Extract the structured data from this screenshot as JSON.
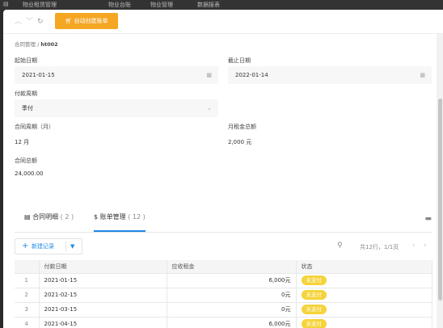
{
  "nav": {
    "items": [
      "物业租赁管理",
      "物业台账",
      "物业管理",
      "数据报表"
    ]
  },
  "toolbar": {
    "up_icon": "chevron-up-icon",
    "down_icon": "chevron-down-icon",
    "refresh_icon": "refresh-icon",
    "auto_bill_label": "自动创建账单"
  },
  "breadcrumb": {
    "parent": "合同管理",
    "current": "ht002"
  },
  "form": {
    "start_label": "起始日期",
    "start_value": "2021-01-15",
    "end_label": "截止日期",
    "end_value": "2022-01-14",
    "cycle_label": "付款周期",
    "cycle_value": "季付",
    "period_label": "合同周期（月）",
    "period_value": "12 月",
    "monthly_label": "月租金总额",
    "monthly_value": "2,000 元",
    "total_label": "合同总额",
    "total_value": "24,000.00"
  },
  "tabs": [
    {
      "label": "合同明细",
      "count": "( 2 )"
    },
    {
      "label": "账单管理",
      "count": "( 12 )"
    }
  ],
  "list_toolbar": {
    "new_label": "新建记录",
    "pager_text": "共12行，1/1页"
  },
  "table": {
    "headers": [
      "",
      "付款日期",
      "应收租金",
      "状态"
    ],
    "rows": [
      {
        "idx": "1",
        "date": "2021-01-15",
        "amount": "6,000元",
        "status": "未支付"
      },
      {
        "idx": "2",
        "date": "2021-02-15",
        "amount": "0元",
        "status": "未支付"
      },
      {
        "idx": "3",
        "date": "2021-03-15",
        "amount": "0元",
        "status": "未支付"
      },
      {
        "idx": "4",
        "date": "2021-04-15",
        "amount": "6,000元",
        "status": "未支付"
      }
    ]
  },
  "colors": {
    "accent": "#1e88e5",
    "orange": "#f5a623",
    "badge": "#f6d33a"
  }
}
